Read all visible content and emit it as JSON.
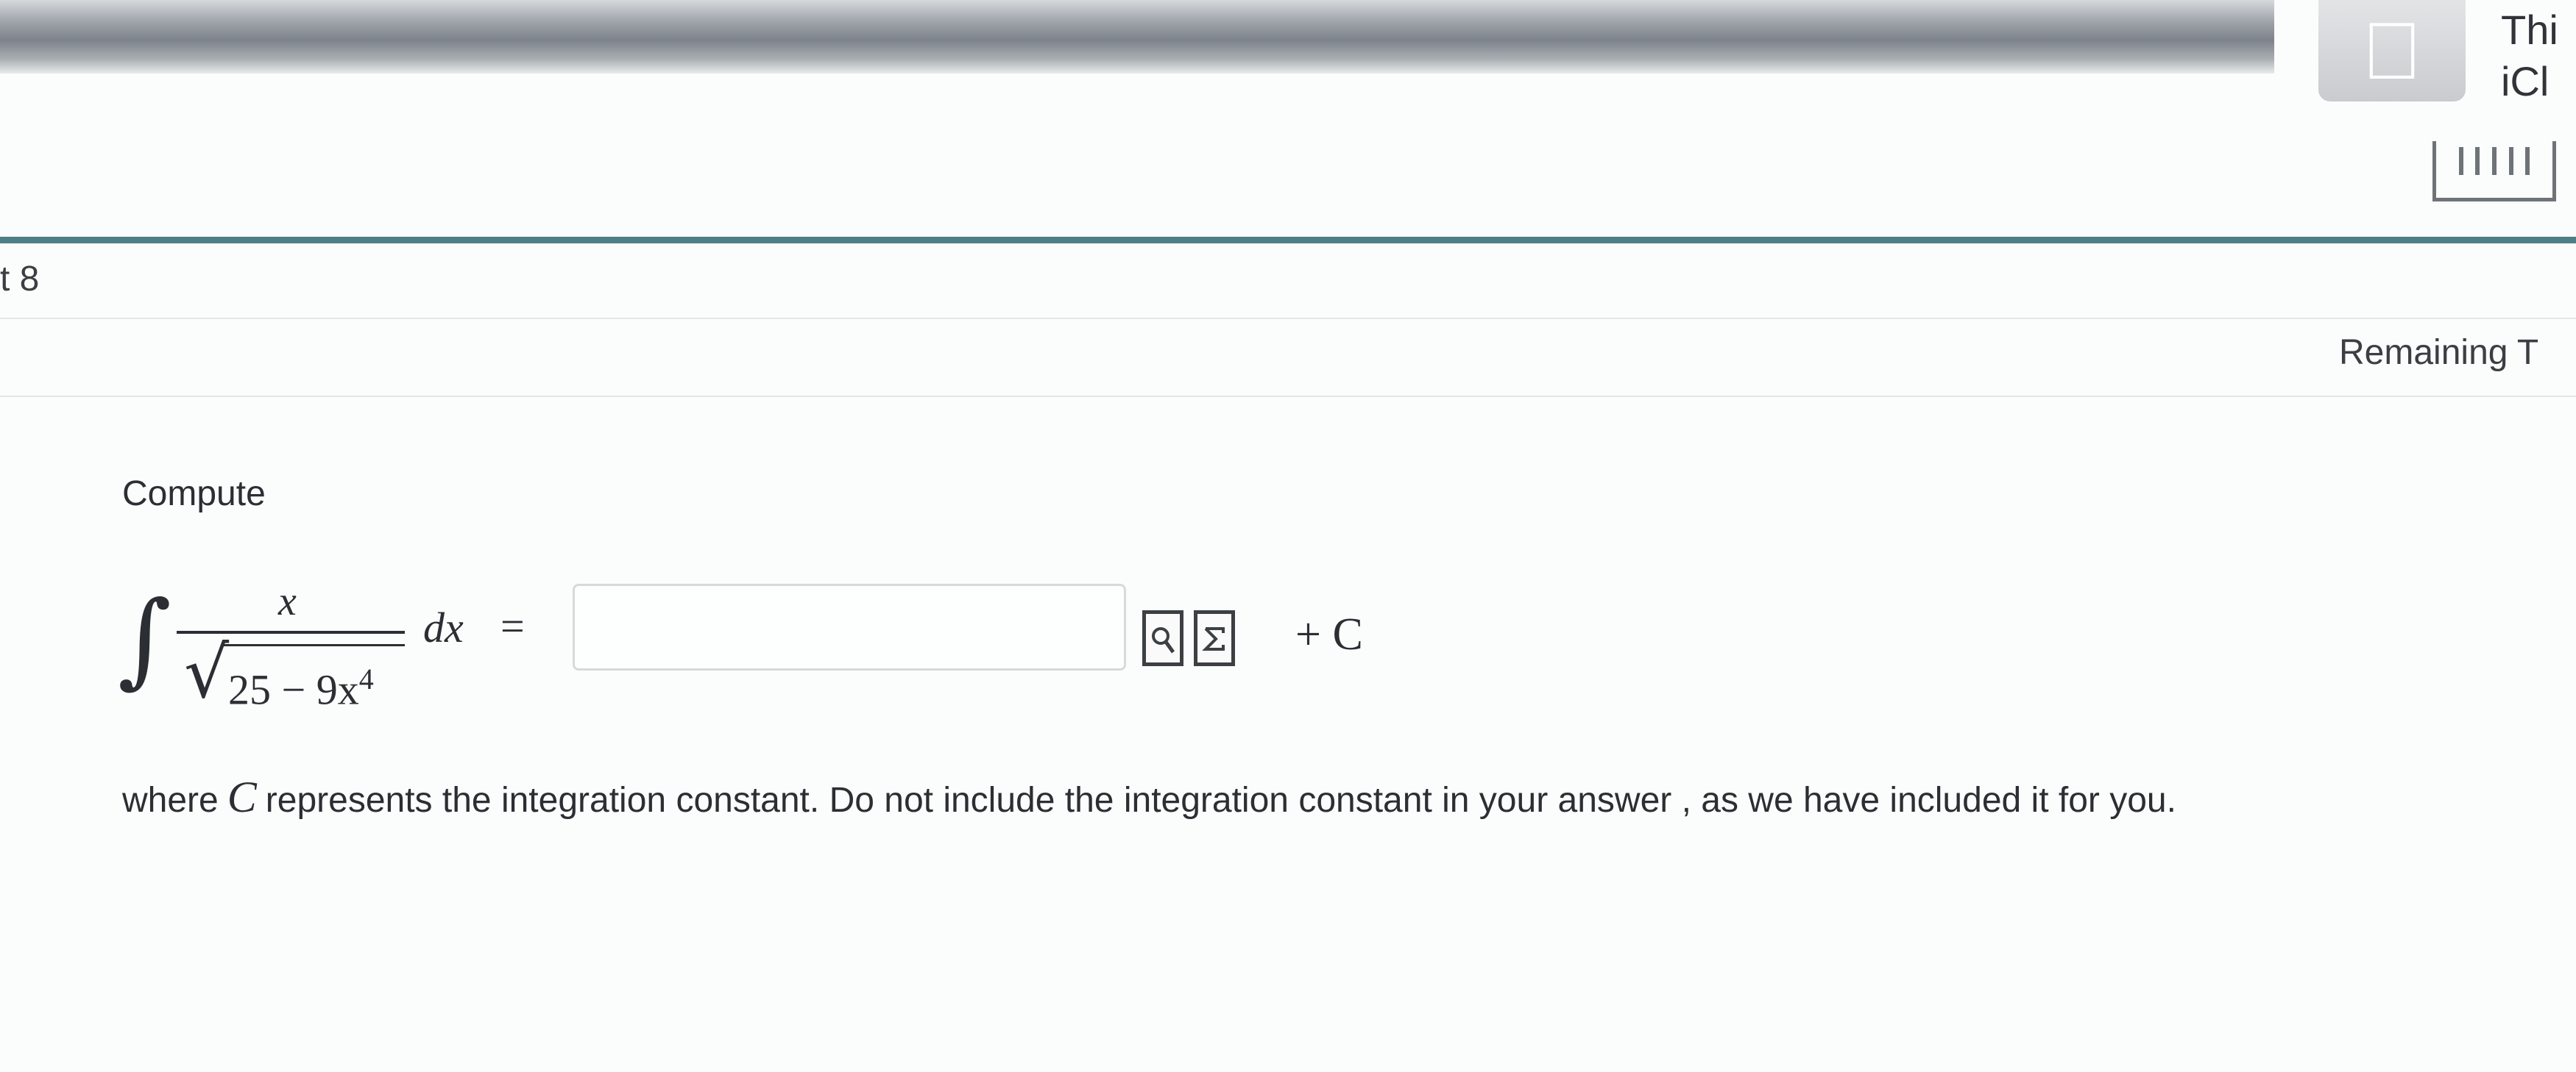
{
  "notification": {
    "line1": "Thi",
    "line2": "iCl"
  },
  "header": {
    "part_label": "t 8",
    "remaining_label": "Remaining T"
  },
  "problem": {
    "prompt": "Compute",
    "integral_symbol": "∫",
    "numerator": "x",
    "denominator_text": "25 − 9x",
    "denominator_exponent": "4",
    "differential": "dx",
    "equals": "=",
    "answer_value": "",
    "constant": "+ C",
    "note_before": "where",
    "note_variable": "C",
    "note_after": "represents the integration constant. Do not include the integration constant in your answer , as we have included it for you."
  },
  "icons": {
    "apple": "apple-logo-icon",
    "keyboard": "keyboard-icon",
    "preview": "preview-formula-icon",
    "equation_editor": "equation-editor-sigma-icon"
  },
  "colors": {
    "header_rule": "#4f7f86",
    "text": "#2b2f33"
  }
}
